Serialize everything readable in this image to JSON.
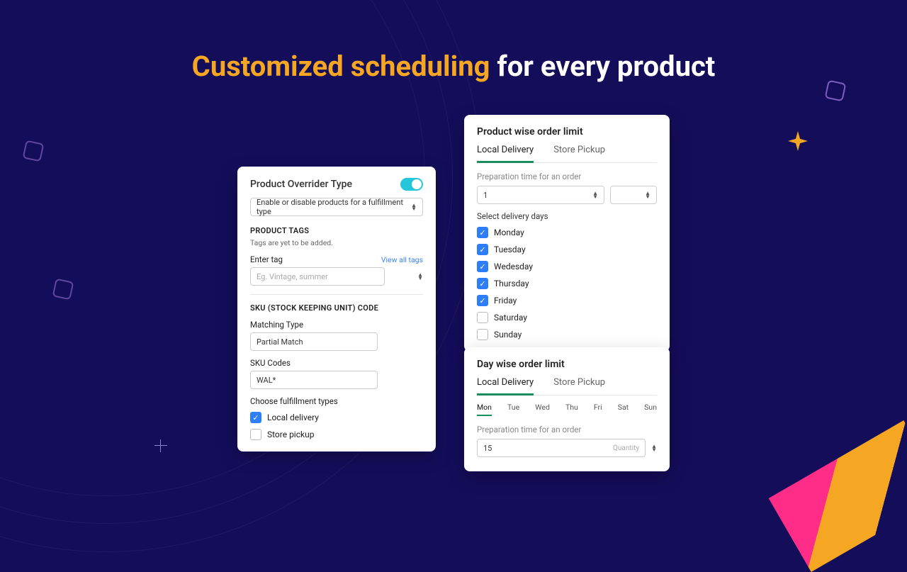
{
  "headline": {
    "accent": "Customized scheduling",
    "rest": " for every product"
  },
  "overrider": {
    "title": "Product Overrider Type",
    "dropdown": "Enable or disable products for a fulfillment type",
    "product_tags_label": "PRODUCT TAGS",
    "product_tags_helper": "Tags are yet to be added.",
    "enter_tag_label": "Enter tag",
    "enter_tag_placeholder": "Eg. Vintage, summer",
    "view_all_tags": "View all tags",
    "sku_section": "SKU (STOCK KEEPING UNIT) CODE",
    "matching_type_label": "Matching Type",
    "matching_type_value": "Partial Match",
    "sku_codes_label": "SKU Codes",
    "sku_codes_value": "WAL*",
    "choose_fulfillment": "Choose fulfillment types",
    "local_delivery": "Local delivery",
    "store_pickup": "Store pickup"
  },
  "productLimit": {
    "title": "Product wise order limit",
    "tab_local": "Local Delivery",
    "tab_store": "Store Pickup",
    "prep_label": "Preparation time for an order",
    "prep_value": "1",
    "select_days": "Select delivery days",
    "days": [
      {
        "name": "Monday",
        "checked": true
      },
      {
        "name": "Tuesday",
        "checked": true
      },
      {
        "name": "Wedesday",
        "checked": true
      },
      {
        "name": "Thursday",
        "checked": true
      },
      {
        "name": "Friday",
        "checked": true
      },
      {
        "name": "Saturday",
        "checked": false
      },
      {
        "name": "Sunday",
        "checked": false
      }
    ]
  },
  "dayLimit": {
    "title": "Day wise order limit",
    "tab_local": "Local Delivery",
    "tab_store": "Store Pickup",
    "day_tabs": [
      "Mon",
      "Tue",
      "Wed",
      "Thu",
      "Fri",
      "Sat",
      "Sun"
    ],
    "prep_label": "Preparation time for an order",
    "prep_value": "15",
    "qty_label": "Quantity"
  }
}
